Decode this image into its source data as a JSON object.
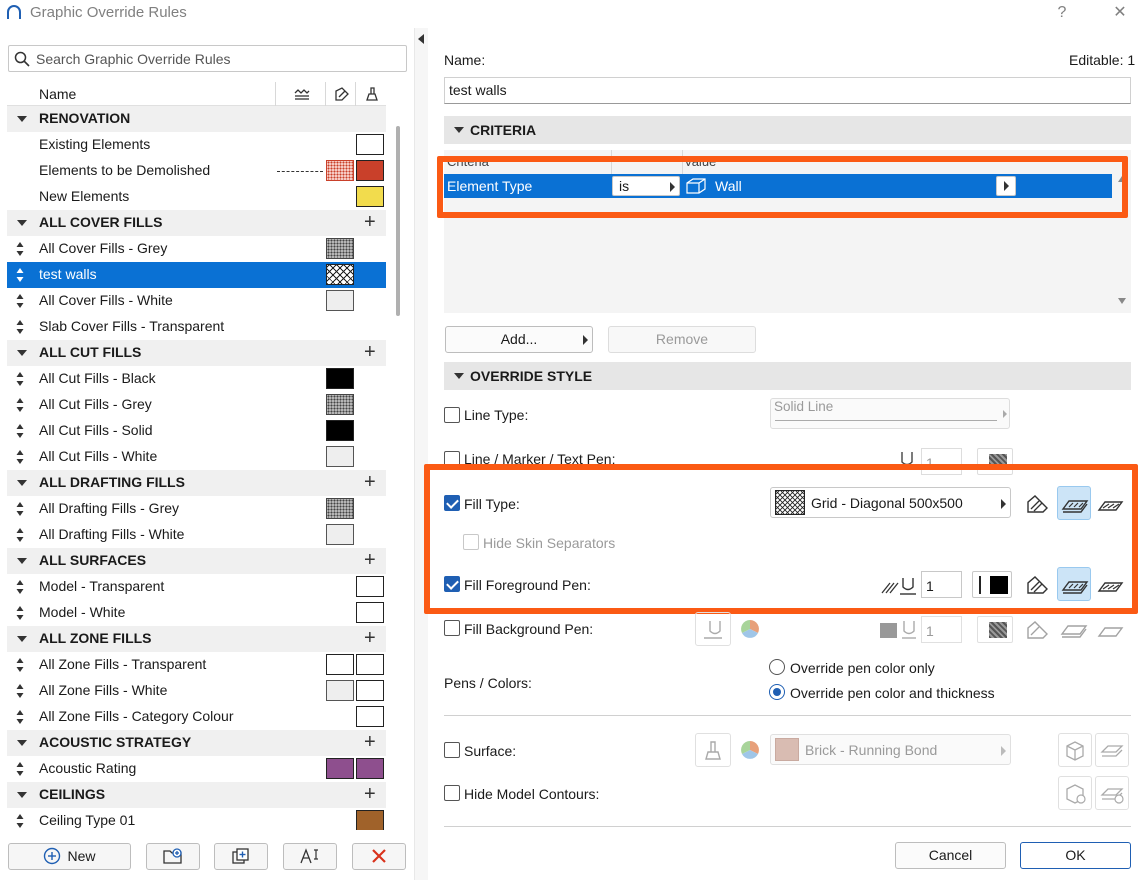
{
  "window": {
    "title": "Graphic Override Rules",
    "help": "?",
    "close": "✕"
  },
  "search": {
    "placeholder": "Search Graphic Override Rules"
  },
  "list_header": {
    "name": "Name"
  },
  "rules": [
    {
      "type": "group",
      "label": "RENOVATION"
    },
    {
      "type": "item",
      "label": "Existing Elements",
      "swatches": [
        {
          "slot": 2,
          "kind": "white"
        }
      ]
    },
    {
      "type": "item",
      "label": "Elements to be Demolished",
      "dashed": true,
      "swatches": [
        {
          "slot": 1,
          "kind": "pink-dots"
        },
        {
          "slot": 2,
          "kind": "red"
        }
      ]
    },
    {
      "type": "item",
      "label": "New Elements",
      "swatches": [
        {
          "slot": 2,
          "kind": "yellow"
        }
      ]
    },
    {
      "type": "group",
      "label": "ALL COVER FILLS",
      "plus": true
    },
    {
      "type": "item",
      "label": "All Cover Fills - Grey",
      "mv": true,
      "swatches": [
        {
          "slot": 1,
          "kind": "grey-dots"
        }
      ]
    },
    {
      "type": "item",
      "label": "test walls",
      "mv": true,
      "selected": true,
      "swatches": [
        {
          "slot": 1,
          "kind": "crosshatch"
        }
      ]
    },
    {
      "type": "item",
      "label": "All Cover Fills - White",
      "mv": true,
      "swatches": [
        {
          "slot": 1,
          "kind": "light"
        }
      ]
    },
    {
      "type": "item",
      "label": "Slab Cover Fills - Transparent",
      "mv": true,
      "swatches": []
    },
    {
      "type": "group",
      "label": "ALL CUT FILLS",
      "plus": true
    },
    {
      "type": "item",
      "label": "All Cut Fills - Black",
      "mv": true,
      "swatches": [
        {
          "slot": 1,
          "kind": "black"
        }
      ]
    },
    {
      "type": "item",
      "label": "All Cut Fills - Grey",
      "mv": true,
      "swatches": [
        {
          "slot": 1,
          "kind": "grey-dots"
        }
      ]
    },
    {
      "type": "item",
      "label": "All Cut Fills - Solid",
      "mv": true,
      "swatches": [
        {
          "slot": 1,
          "kind": "black"
        }
      ]
    },
    {
      "type": "item",
      "label": "All Cut Fills - White",
      "mv": true,
      "swatches": [
        {
          "slot": 1,
          "kind": "light"
        }
      ]
    },
    {
      "type": "group",
      "label": "ALL DRAFTING FILLS",
      "plus": true
    },
    {
      "type": "item",
      "label": "All Drafting Fills - Grey",
      "mv": true,
      "swatches": [
        {
          "slot": 1,
          "kind": "grey-dots"
        }
      ]
    },
    {
      "type": "item",
      "label": "All Drafting Fills - White",
      "mv": true,
      "swatches": [
        {
          "slot": 1,
          "kind": "light"
        }
      ]
    },
    {
      "type": "group",
      "label": "ALL SURFACES",
      "plus": true
    },
    {
      "type": "item",
      "label": "Model - Transparent",
      "mv": true,
      "swatches": [
        {
          "slot": 2,
          "kind": "white"
        }
      ]
    },
    {
      "type": "item",
      "label": "Model - White",
      "mv": true,
      "swatches": [
        {
          "slot": 2,
          "kind": "white"
        }
      ]
    },
    {
      "type": "group",
      "label": "ALL ZONE FILLS",
      "plus": true
    },
    {
      "type": "item",
      "label": "All Zone Fills - Transparent",
      "mv": true,
      "swatches": [
        {
          "slot": 1,
          "kind": "white"
        },
        {
          "slot": 2,
          "kind": "white"
        }
      ]
    },
    {
      "type": "item",
      "label": "All Zone Fills - White",
      "mv": true,
      "swatches": [
        {
          "slot": 1,
          "kind": "light"
        },
        {
          "slot": 2,
          "kind": "white"
        }
      ]
    },
    {
      "type": "item",
      "label": "All Zone Fills - Category Colour",
      "mv": true,
      "swatches": [
        {
          "slot": 2,
          "kind": "white"
        }
      ]
    },
    {
      "type": "group",
      "label": "ACOUSTIC STRATEGY",
      "plus": true
    },
    {
      "type": "item",
      "label": "Acoustic Rating",
      "mv": true,
      "swatches": [
        {
          "slot": 1,
          "kind": "purple"
        },
        {
          "slot": 2,
          "kind": "purple"
        }
      ]
    },
    {
      "type": "group",
      "label": "CEILINGS",
      "plus": true
    },
    {
      "type": "item",
      "label": "Ceiling Type 01",
      "mv": true,
      "swatches": [
        {
          "slot": 2,
          "kind": "brown"
        }
      ]
    }
  ],
  "swatch_colors": {
    "white": "#ffffff",
    "light": "#eeeeee",
    "black": "#000000",
    "red": "#c9402a",
    "yellow": "#f2dc4d",
    "purple": "#8e4f8e",
    "brown": "#a0622a",
    "pink": "#f7cfc8",
    "grey": "#b9b9b9"
  },
  "bottom_buttons": {
    "new": "New"
  },
  "detail": {
    "name_label": "Name:",
    "editable": "Editable: 1",
    "name_value": "test walls",
    "criteria_header": "CRITERIA",
    "criteria_cols": {
      "criteria": "Criteria",
      "value": "Value"
    },
    "criteria_row": {
      "criteria": "Element Type",
      "operator": "is",
      "value": "Wall"
    },
    "add_button": "Add...",
    "remove_button": "Remove",
    "override_header": "OVERRIDE STYLE",
    "line_type": {
      "label": "Line Type:",
      "value": "Solid Line"
    },
    "line_pen": {
      "label": "Line / Marker / Text Pen:",
      "value": "1"
    },
    "fill_type": {
      "label": "Fill Type:",
      "value": "Grid - Diagonal 500x500"
    },
    "hide_skin": {
      "label": "Hide Skin Separators"
    },
    "fill_fg_pen": {
      "label": "Fill Foreground Pen:",
      "value": "1"
    },
    "fill_bg_pen": {
      "label": "Fill Background Pen:",
      "value": "1"
    },
    "pens_colors": {
      "label": "Pens / Colors:",
      "opt1": "Override pen color only",
      "opt2": "Override pen color and thickness"
    },
    "surface": {
      "label": "Surface:",
      "value": "Brick - Running Bond"
    },
    "hide_contours": {
      "label": "Hide Model Contours:"
    },
    "cancel": "Cancel",
    "ok": "OK"
  }
}
